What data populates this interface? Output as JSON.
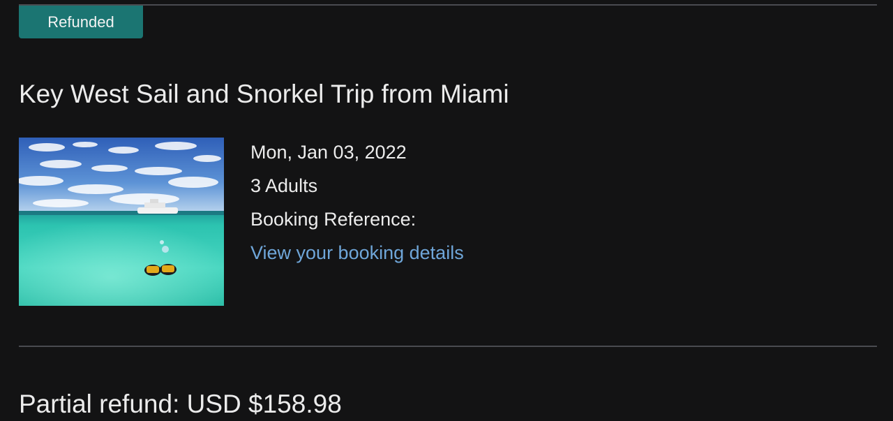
{
  "booking": {
    "status": "Refunded",
    "title": "Key West Sail and Snorkel Trip from Miami",
    "date": "Mon, Jan 03, 2022",
    "travelers": "3 Adults",
    "reference_label": "Booking Reference:",
    "details_link": "View your booking details",
    "refund": "Partial refund: USD $158.98"
  },
  "colors": {
    "background": "#131314",
    "badge": "#1b7572",
    "link": "#6fa6d9",
    "divider": "#4a4b50",
    "text": "#ececec"
  },
  "image": {
    "subject": "snorkelers-near-boat-in-turquoise-water"
  }
}
